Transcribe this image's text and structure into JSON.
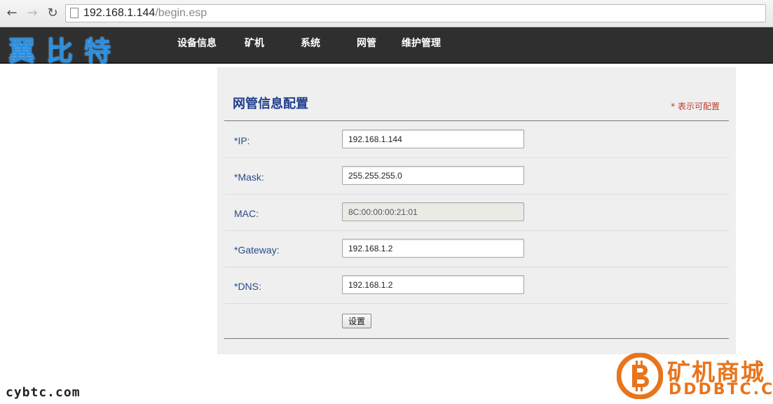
{
  "browser": {
    "url_host": "192.168.1.144",
    "url_path": "/begin.esp"
  },
  "header": {
    "logo": "翼比特",
    "nav": [
      "设备信息",
      "矿机",
      "系统",
      "网管",
      "维护管理"
    ]
  },
  "panel": {
    "title": "网管信息配置",
    "note": "* 表示可配置",
    "fields": [
      {
        "label": "*IP:",
        "value": "192.168.1.144",
        "editable": true
      },
      {
        "label": "*Mask:",
        "value": "255.255.255.0",
        "editable": true
      },
      {
        "label": "MAC:",
        "value": "8C:00:00:00:21:01",
        "editable": false
      },
      {
        "label": "*Gateway:",
        "value": "192.168.1.2",
        "editable": true
      },
      {
        "label": "*DNS:",
        "value": "192.168.1.2",
        "editable": true
      }
    ],
    "submit_label": "设置"
  },
  "watermark": {
    "left_text": "cybtc.com",
    "brand": "矿机商城",
    "domain": "DDDBTC.COM"
  },
  "icons": {
    "back": "back-arrow-icon",
    "forward": "forward-arrow-icon",
    "reload": "reload-icon",
    "page": "page-icon",
    "brand_logo": "bitcoin-logo-icon"
  },
  "colors": {
    "header_bg": "#2f2f2f",
    "logo": "#2b8fe0",
    "title": "#1f3f8f",
    "label": "#2a4a90",
    "note": "#c0392b",
    "panel_bg": "#efefef",
    "watermark": "#e8741c"
  }
}
